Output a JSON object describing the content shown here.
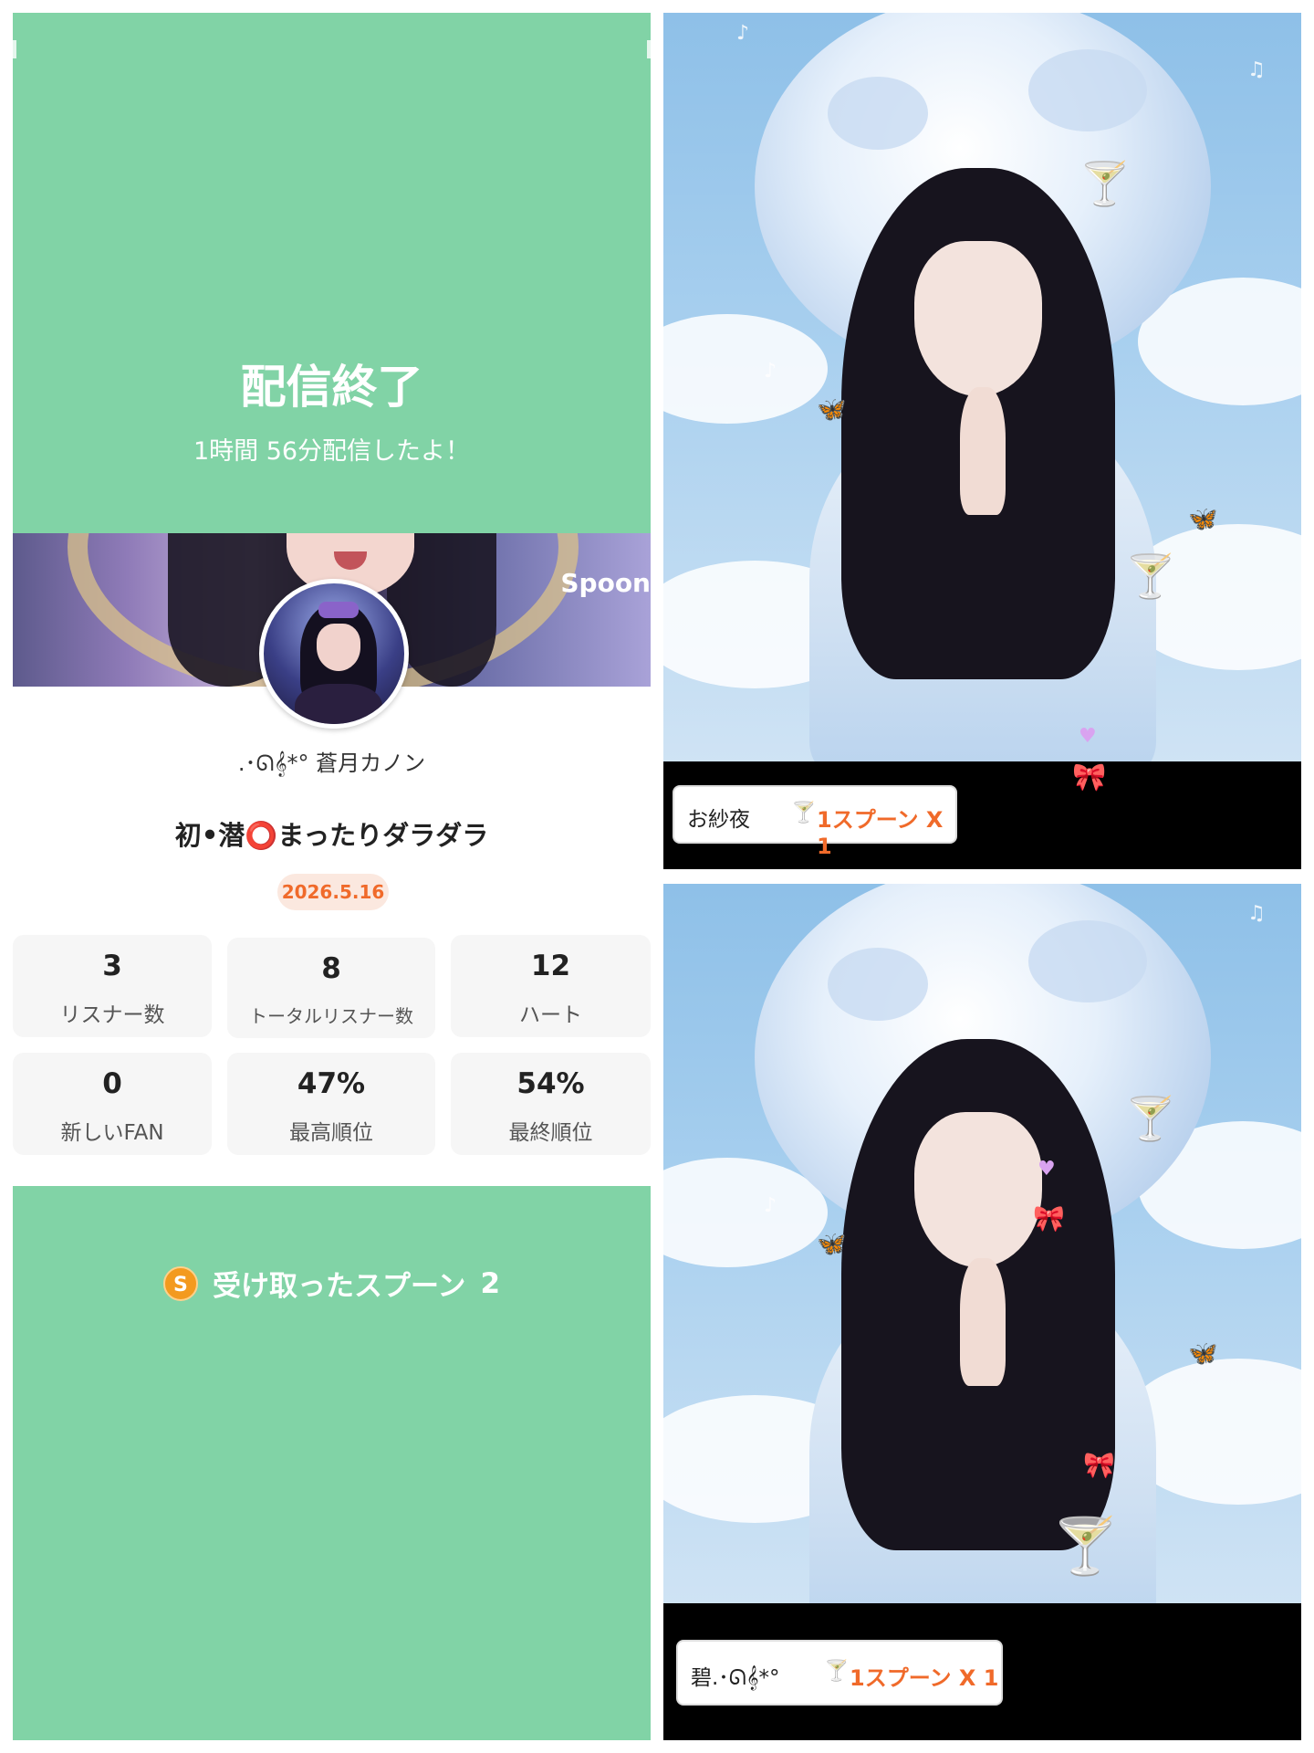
{
  "colors": {
    "green": "#81d3a6",
    "orange": "#f06a2a",
    "badge_bg": "#fbe8df"
  },
  "broadcast_end": {
    "title": "配信終了",
    "subtitle": "1時間 56分配信したよ！"
  },
  "banner": {
    "logo": "Spoon"
  },
  "profile": {
    "nickname": ".･ᘏ𝄞*° 蒼月カノン",
    "live_title": "初•潜⭕まったりダラダラ",
    "date": "2026.5.16"
  },
  "stats": [
    {
      "value": "3",
      "label": "リスナー数"
    },
    {
      "value": "8",
      "label": "トータルリスナー数"
    },
    {
      "value": "12",
      "label": "ハート"
    },
    {
      "value": "0",
      "label": "新しいFAN"
    },
    {
      "value": "47%",
      "label": "最高順位"
    },
    {
      "value": "54%",
      "label": "最終順位"
    }
  ],
  "spoons": {
    "coin": "S",
    "label": "受け取ったスプーン",
    "count": "2"
  },
  "gifts": [
    {
      "name": "お紗夜",
      "icon": "cocktail-glass-icon",
      "text": "1スプーン X 1"
    },
    {
      "name": "碧.･ᘏ𝄞*°",
      "icon": "cocktail-glass-icon",
      "text": "1スプーン X 1"
    }
  ]
}
